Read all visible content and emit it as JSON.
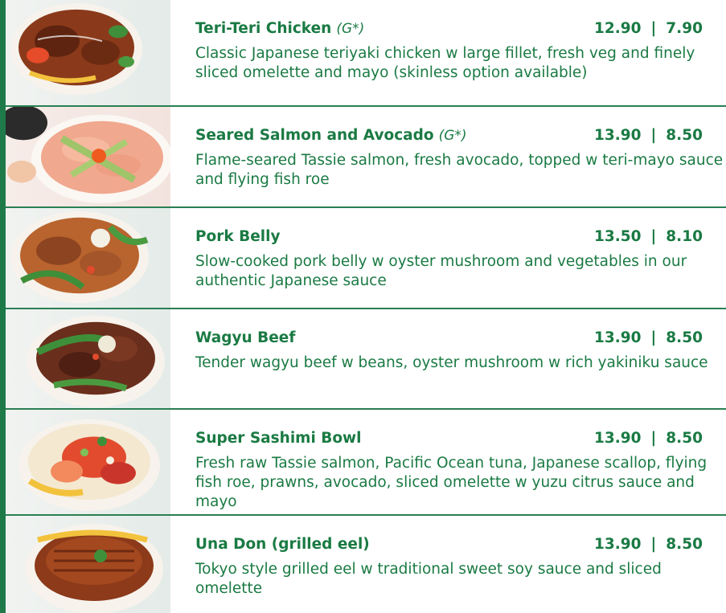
{
  "brand": {
    "accent": "#1a7a43",
    "rule": "#2a7f53"
  },
  "items": [
    {
      "name": "Teri-Teri Chicken",
      "tag": "(G*)",
      "price_large": "12.90",
      "price_sep": "|",
      "price_small": "7.90",
      "desc": "Classic Japanese teriyaki chicken w large fillet, fresh veg and finely sliced omelette and mayo (skinless option available)",
      "photo": "teriyaki-chicken-bowl-photo"
    },
    {
      "name": "Seared Salmon and Avocado",
      "tag": "(G*)",
      "price_large": "13.90",
      "price_sep": "|",
      "price_small": "8.50",
      "desc": "Flame-seared Tassie salmon, fresh avocado, topped w teri-mayo sauce and flying fish roe",
      "photo": "salmon-avocado-bowl-photo"
    },
    {
      "name": "Pork Belly",
      "tag": "",
      "price_large": "13.50",
      "price_sep": "|",
      "price_small": "8.10",
      "desc": "Slow-cooked pork belly w oyster mushroom and vegetables in our authentic Japanese sauce",
      "photo": "pork-belly-bowl-photo"
    },
    {
      "name": "Wagyu Beef",
      "tag": "",
      "price_large": "13.90",
      "price_sep": "|",
      "price_small": "8.50",
      "desc": "Tender wagyu beef w beans, oyster mushroom w rich yakiniku sauce",
      "photo": "wagyu-beef-bowl-photo"
    },
    {
      "name": "Super Sashimi Bowl",
      "tag": "",
      "price_large": "13.90",
      "price_sep": "|",
      "price_small": "8.50",
      "desc": "Fresh raw Tassie salmon, Pacific Ocean tuna, Japanese scallop, flying fish roe, prawns, avocado, sliced omelette w yuzu citrus sauce and mayo",
      "photo": "sashimi-bowl-photo"
    },
    {
      "name": "Una Don (grilled eel)",
      "tag": "",
      "price_large": "13.90",
      "price_sep": "|",
      "price_small": "8.50",
      "desc": "Tokyo style grilled eel w traditional sweet soy sauce and sliced omelette",
      "photo": "eel-bowl-photo"
    }
  ]
}
